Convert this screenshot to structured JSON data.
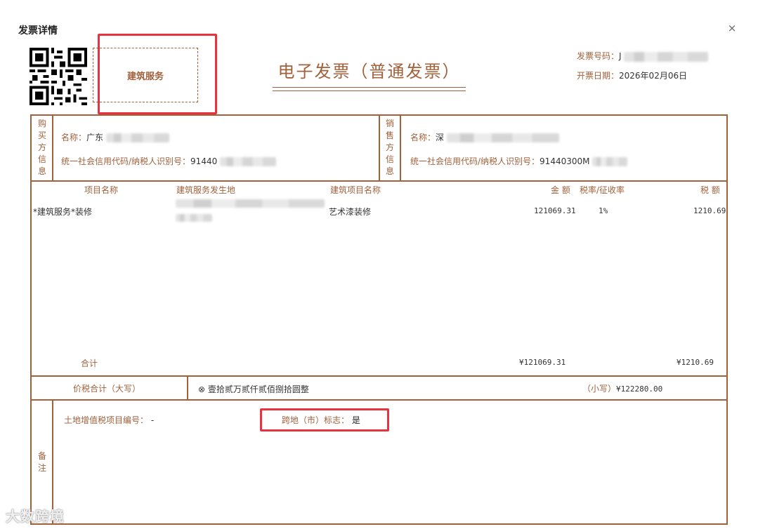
{
  "dialog": {
    "title": "发票详情",
    "close_glyph": "×"
  },
  "invoice": {
    "category": "建筑服务",
    "title": "电子发票（普通发票）",
    "number_label": "发票号码：",
    "number_value": "J",
    "date_label": "开票日期：",
    "date_value": "2026年02月06日"
  },
  "buyer": {
    "section_label": [
      "购",
      "买",
      "方",
      "信",
      "息"
    ],
    "name_label": "名称：",
    "name_value": "广东",
    "tax_id_label": "统一社会信用代码/纳税人识别号：",
    "tax_id_value": "91440"
  },
  "seller": {
    "section_label": [
      "销",
      "售",
      "方",
      "信",
      "息"
    ],
    "name_label": "名称：",
    "name_value": "深",
    "tax_id_label": "统一社会信用代码/纳税人识别号：",
    "tax_id_value": "91440300M"
  },
  "items": {
    "headers": {
      "item_name": "项目名称",
      "location": "建筑服务发生地",
      "project": "建筑项目名称",
      "amount": "金 额",
      "rate": "税率/征收率",
      "tax": "税 额"
    },
    "rows": [
      {
        "item_name": "*建筑服务*装修",
        "project": "艺术漆装修",
        "amount": "121069.31",
        "rate": "1%",
        "tax": "1210.69"
      }
    ],
    "total_label": "合计",
    "total_amount": "¥121069.31",
    "total_tax": "¥1210.69"
  },
  "grand_total": {
    "label": "价税合计（大写）",
    "icon": "⊗",
    "words": "壹拾贰万贰仟贰佰捌拾圆整",
    "small_label": "（小写）",
    "small_value": "¥122280.00"
  },
  "remarks": {
    "section_label": [
      "备",
      "注"
    ],
    "land_vat_label": "土地增值税项目编号：",
    "land_vat_value": "-",
    "cross_region_label": "跨地（市）标志：",
    "cross_region_value": "是"
  },
  "watermark": "大数跨境",
  "colors": {
    "accent": "#a0613b",
    "highlight": "#e8333f"
  }
}
